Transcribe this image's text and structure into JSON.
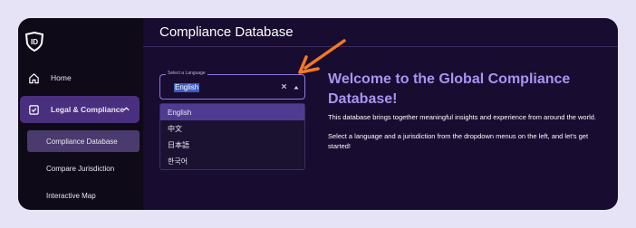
{
  "sidebar": {
    "items": [
      {
        "label": "Home",
        "icon": "home-icon"
      },
      {
        "label": "Legal & Compliance",
        "icon": "checkbox-icon",
        "expanded": true
      }
    ],
    "subitems": [
      {
        "label": "Compliance Database",
        "active": true
      },
      {
        "label": "Compare Jurisdiction"
      },
      {
        "label": "Interactive Map"
      }
    ]
  },
  "header": {
    "title": "Compliance Database"
  },
  "language_select": {
    "label": "Select a Language",
    "value": "English",
    "options": [
      "English",
      "中文",
      "日本語",
      "한국어"
    ]
  },
  "welcome": {
    "title": "Welcome to the Global Compliance Database!",
    "paragraph1": "This database brings together meaningful insights and experience from around the world.",
    "paragraph2": "Select a language and a jurisdiction from the dropdown menus on the left, and let's get started!"
  },
  "colors": {
    "accent": "#a994f2",
    "active_nav": "#4a2f7e",
    "annotation_arrow": "#f47920"
  }
}
